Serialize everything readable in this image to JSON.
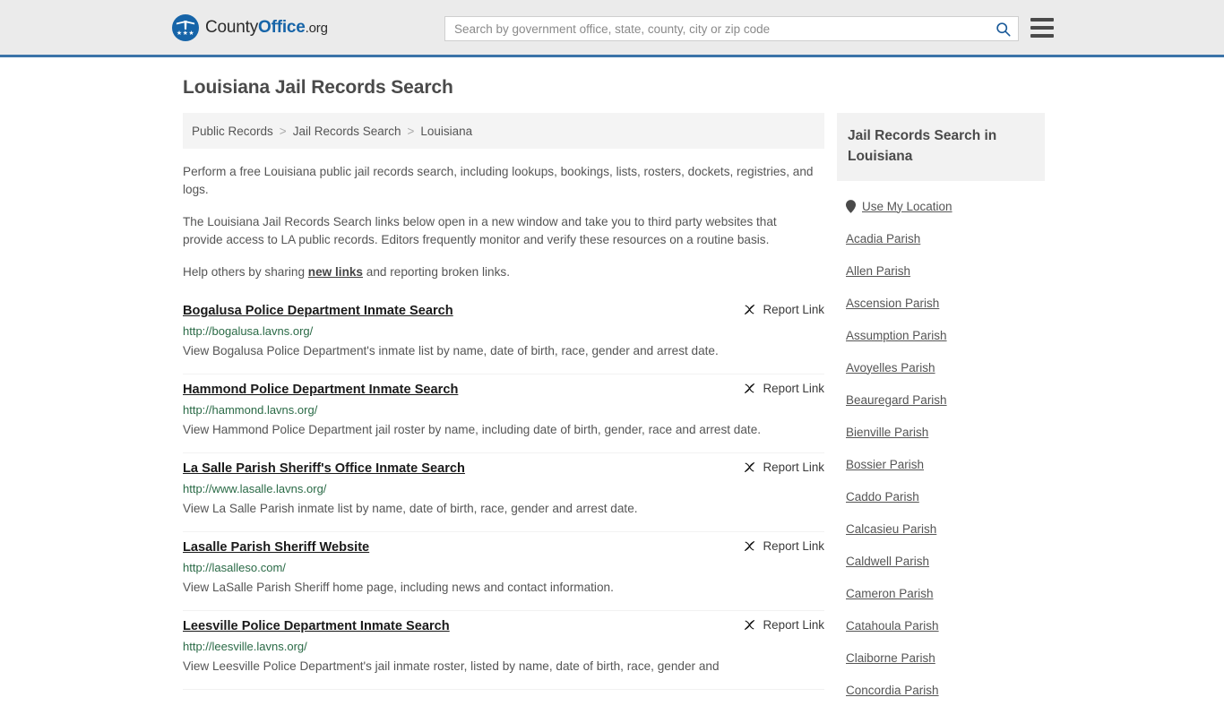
{
  "header": {
    "logo": {
      "part1": "County",
      "part2": "Office",
      "part3": ".org",
      "stars": "★★★"
    },
    "search": {
      "placeholder": "Search by government office, state, county, city or zip code",
      "value": ""
    },
    "menu_label": "menu",
    "accent_color": "#3b73a8",
    "background_color": "#ebebeb"
  },
  "page_title": "Louisiana Jail Records Search",
  "breadcrumb": {
    "items": [
      {
        "label": "Public Records"
      },
      {
        "label": "Jail Records Search"
      },
      {
        "label": "Louisiana"
      }
    ],
    "separator": ">"
  },
  "intro": {
    "p1": "Perform a free Louisiana public jail records search, including lookups, bookings, lists, rosters, dockets, registries, and logs.",
    "p2": "The Louisiana Jail Records Search links below open in a new window and take you to third party websites that provide access to LA public records. Editors frequently monitor and verify these resources on a routine basis.",
    "p3_before": "Help others by sharing ",
    "p3_link": "new links",
    "p3_after": " and reporting broken links."
  },
  "report_link_label": "Report Link",
  "results": [
    {
      "title": "Bogalusa Police Department Inmate Search",
      "url": "http://bogalusa.lavns.org/",
      "description": "View Bogalusa Police Department's inmate list by name, date of birth, race, gender and arrest date."
    },
    {
      "title": "Hammond Police Department Inmate Search",
      "url": "http://hammond.lavns.org/",
      "description": "View Hammond Police Department jail roster by name, including date of birth, gender, race and arrest date."
    },
    {
      "title": "La Salle Parish Sheriff's Office Inmate Search",
      "url": "http://www.lasalle.lavns.org/",
      "description": "View La Salle Parish inmate list by name, date of birth, race, gender and arrest date."
    },
    {
      "title": "Lasalle Parish Sheriff Website",
      "url": "http://lasalleso.com/",
      "description": "View LaSalle Parish Sheriff home page, including news and contact information."
    },
    {
      "title": "Leesville Police Department Inmate Search",
      "url": "http://leesville.lavns.org/",
      "description": "View Leesville Police Department's jail inmate roster, listed by name, date of birth, race, gender and"
    }
  ],
  "sidebar": {
    "heading": "Jail Records Search in Louisiana",
    "use_my_location": "Use My Location",
    "items": [
      {
        "label": "Acadia Parish"
      },
      {
        "label": "Allen Parish"
      },
      {
        "label": "Ascension Parish"
      },
      {
        "label": "Assumption Parish"
      },
      {
        "label": "Avoyelles Parish"
      },
      {
        "label": "Beauregard Parish"
      },
      {
        "label": "Bienville Parish"
      },
      {
        "label": "Bossier Parish"
      },
      {
        "label": "Caddo Parish"
      },
      {
        "label": "Calcasieu Parish"
      },
      {
        "label": "Caldwell Parish"
      },
      {
        "label": "Cameron Parish"
      },
      {
        "label": "Catahoula Parish"
      },
      {
        "label": "Claiborne Parish"
      },
      {
        "label": "Concordia Parish"
      }
    ]
  },
  "colors": {
    "url_green": "#2a6a46",
    "link_blue": "#1664a8",
    "text_gray": "#555555"
  }
}
